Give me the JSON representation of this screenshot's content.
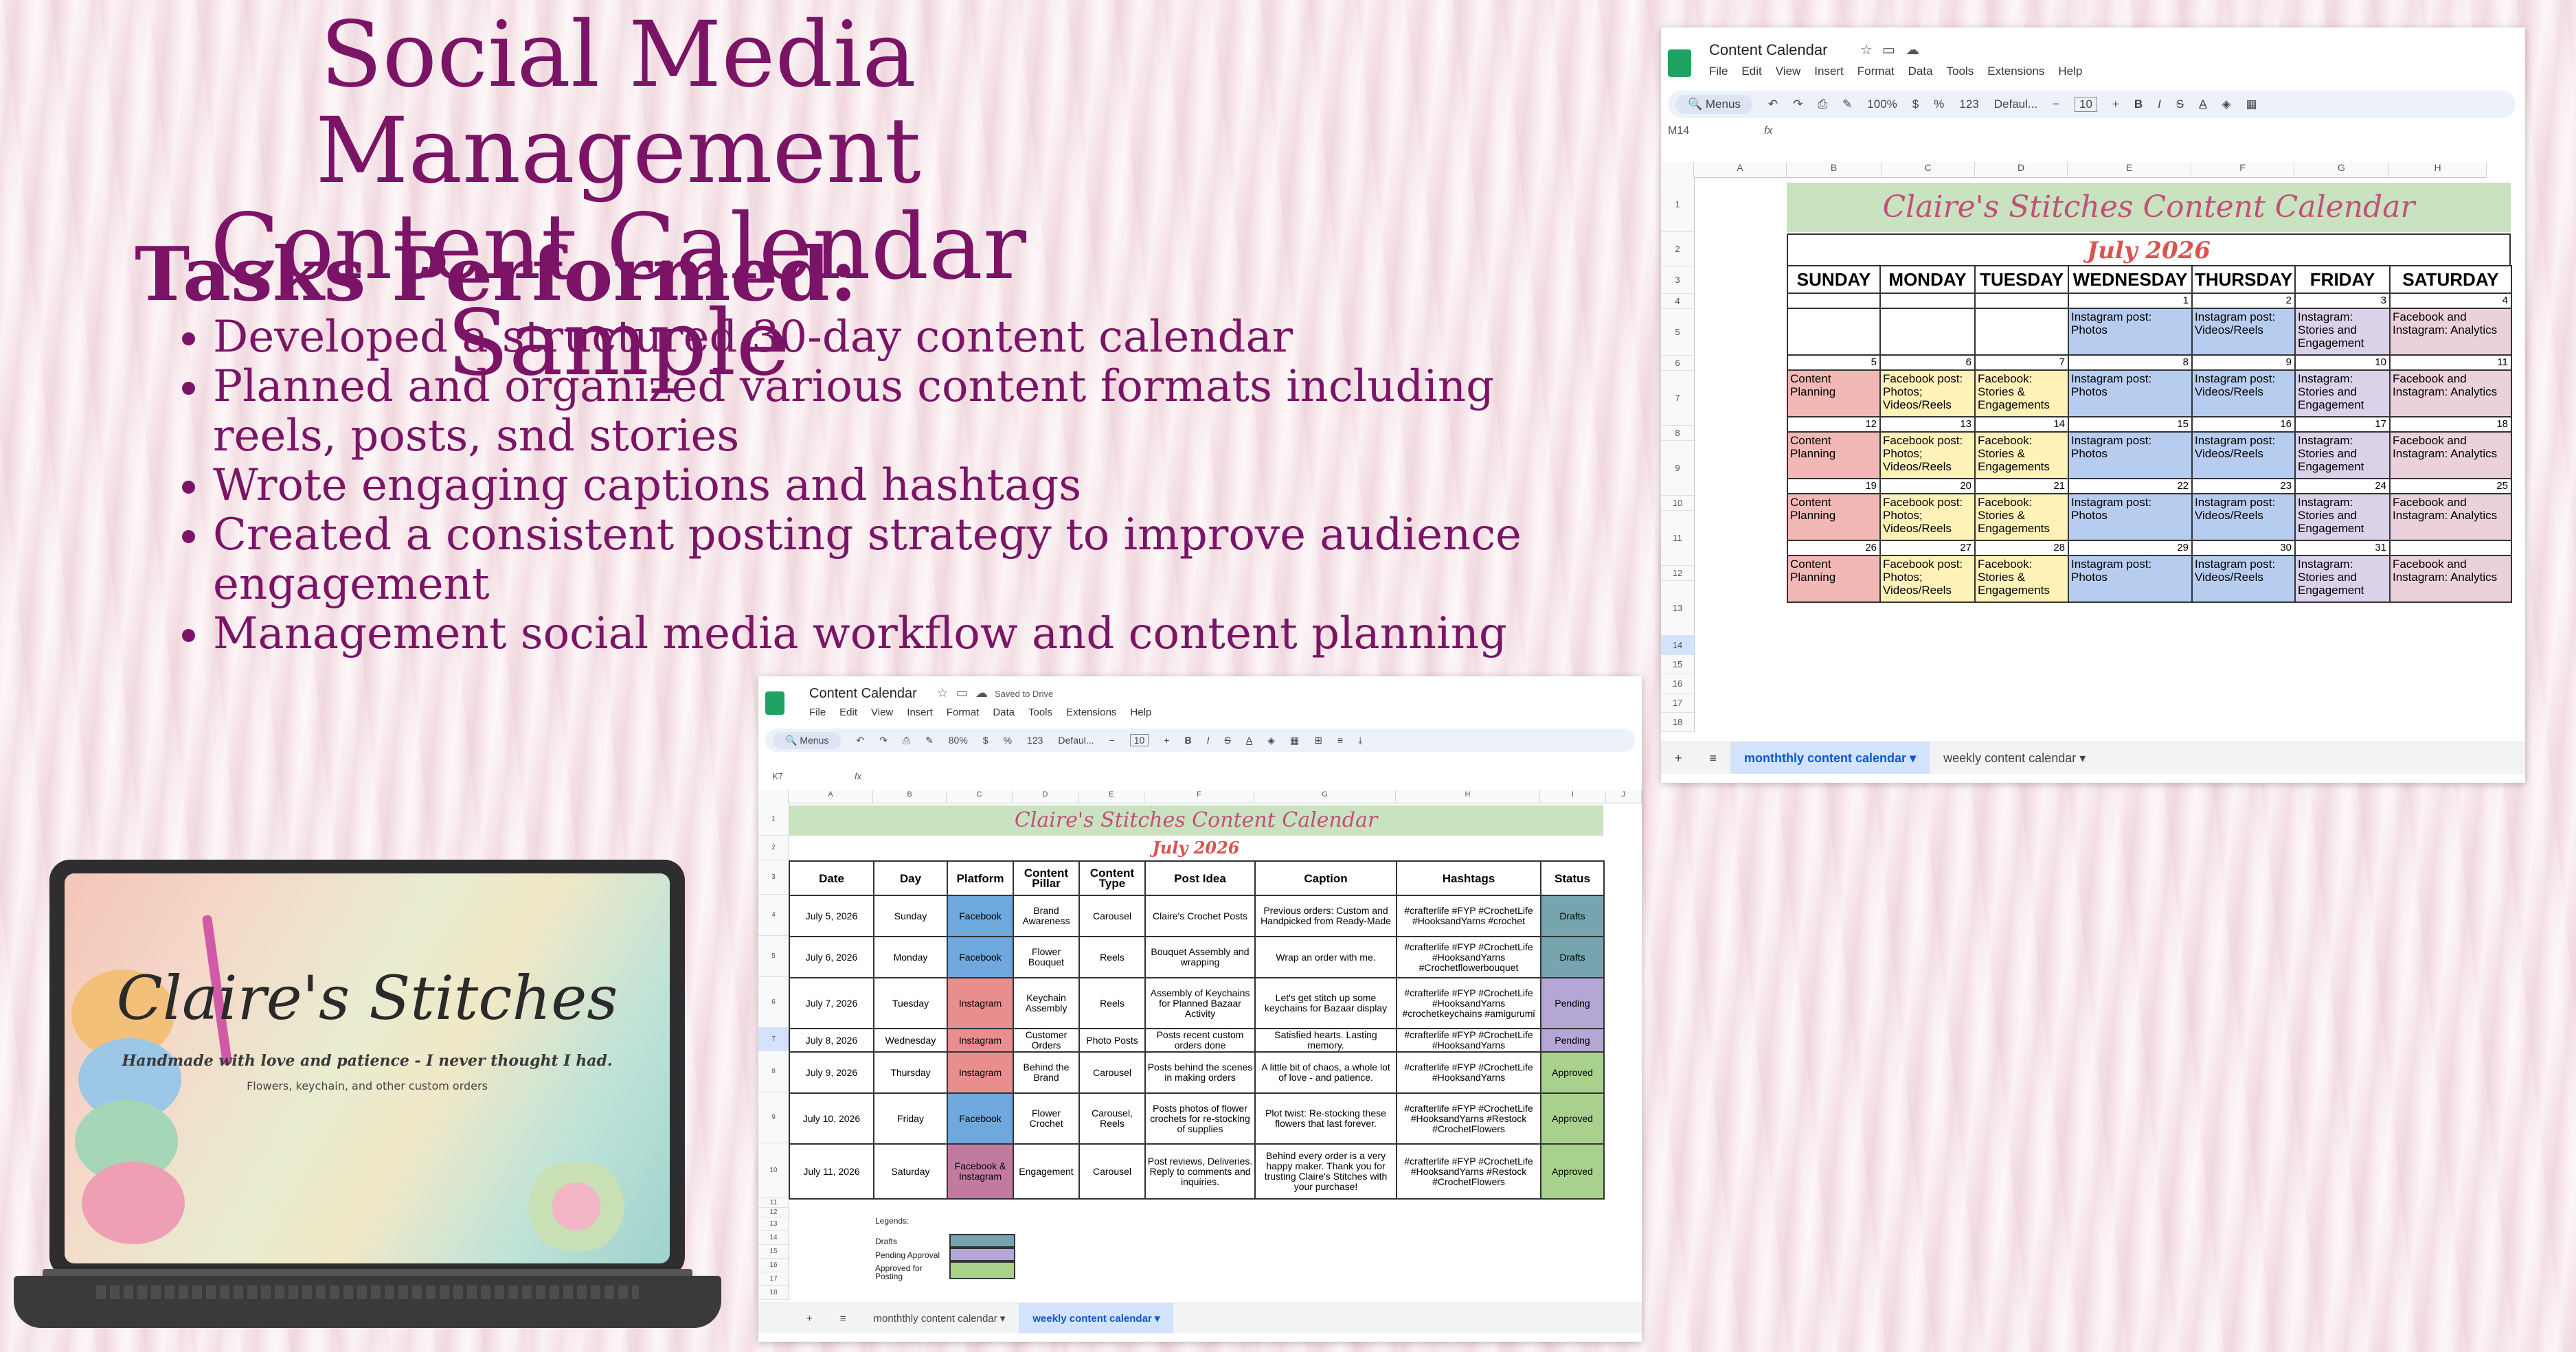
{
  "heading": {
    "title_line1": "Social Media Management",
    "title_line2": "Content Calendar Sample",
    "tasks_heading": "Tasks Performed:",
    "tasks": [
      "Developed a structured 30-day content calendar",
      "Planned and organized various content formats including reels, posts, snd stories",
      "Wrote engaging captions and hashtags",
      "Created a consistent posting strategy to improve audience engagement",
      "Management social media workflow and content planning"
    ]
  },
  "laptop": {
    "brand": "Claire's Stitches",
    "tagline": "Handmade with love and patience - I never thought I had.",
    "subline": "Flowers, keychain, and other custom orders"
  },
  "monthly_sheet": {
    "doc_title": "Content Calendar",
    "menu": [
      "File",
      "Edit",
      "View",
      "Insert",
      "Format",
      "Data",
      "Tools",
      "Extensions",
      "Help"
    ],
    "toolbar": {
      "search": "Menus",
      "zoom": "100%",
      "currency": "$",
      "percent": "%",
      "num": "123",
      "font": "Defaul...",
      "font_size": "10"
    },
    "cell_ref": "M14",
    "columns": [
      "A",
      "B",
      "C",
      "D",
      "E",
      "F",
      "G",
      "H"
    ],
    "rows": [
      "1",
      "2",
      "3",
      "4",
      "5",
      "6",
      "7",
      "8",
      "9",
      "10",
      "11",
      "12",
      "13",
      "14",
      "15",
      "16",
      "17",
      "18"
    ],
    "cal_title": "Claire's Stitches Content Calendar",
    "month": "July 2026",
    "days": [
      "SUNDAY",
      "MONDAY",
      "TUESDAY",
      "WEDNESDAY",
      "THURSDAY",
      "FRIDAY",
      "SATURDAY"
    ],
    "weeks": [
      {
        "nums": [
          "",
          "",
          "",
          "1",
          "2",
          "3",
          "4"
        ],
        "cells": [
          "",
          "",
          "",
          "Instagram post: Photos",
          "Instagram post: Videos/Reels",
          "Instagram: Stories and Engagement",
          "Facebook and Instagram: Analytics"
        ]
      },
      {
        "nums": [
          "5",
          "6",
          "7",
          "8",
          "9",
          "10",
          "11"
        ],
        "cells": [
          "Content Planning",
          "Facebook post: Photos; Videos/Reels",
          "Facebook: Stories & Engagements",
          "Instagram post: Photos",
          "Instagram post: Videos/Reels",
          "Instagram: Stories and Engagement",
          "Facebook and Instagram: Analytics"
        ]
      },
      {
        "nums": [
          "12",
          "13",
          "14",
          "15",
          "16",
          "17",
          "18"
        ],
        "cells": [
          "Content Planning",
          "Facebook post: Photos; Videos/Reels",
          "Facebook: Stories & Engagements",
          "Instagram post: Photos",
          "Instagram post: Videos/Reels",
          "Instagram: Stories and Engagement",
          "Facebook and Instagram: Analytics"
        ]
      },
      {
        "nums": [
          "19",
          "20",
          "21",
          "22",
          "23",
          "24",
          "25"
        ],
        "cells": [
          "Content Planning",
          "Facebook post: Photos; Videos/Reels",
          "Facebook: Stories & Engagements",
          "Instagram post: Photos",
          "Instagram post: Videos/Reels",
          "Instagram: Stories and Engagement",
          "Facebook and Instagram: Analytics"
        ]
      },
      {
        "nums": [
          "26",
          "27",
          "28",
          "29",
          "30",
          "31",
          ""
        ],
        "cells": [
          "Content Planning",
          "Facebook post: Photos; Videos/Reels",
          "Facebook: Stories & Engagements",
          "Instagram post: Photos",
          "Instagram post: Videos/Reels",
          "Instagram: Stories and Engagement",
          "Facebook and Instagram: Analytics"
        ]
      }
    ],
    "colors": {
      "planning": "#f2b8b5",
      "facebook": "#fff2b8",
      "fb_stories": "#fff2b8",
      "ig_photos": "#b7cdf0",
      "ig_reels": "#b7cdf0",
      "ig_stories": "#d9d2e9",
      "analytics": "#ead1dc",
      "title_bg": "#c9e2c0"
    },
    "tabs": {
      "monthly": "monththly content calendar",
      "weekly": "weekly content calendar"
    }
  },
  "weekly_sheet": {
    "doc_title": "Content Calendar",
    "saved": "Saved to Drive",
    "menu": [
      "File",
      "Edit",
      "View",
      "Insert",
      "Format",
      "Data",
      "Tools",
      "Extensions",
      "Help"
    ],
    "toolbar": {
      "search": "Menus",
      "zoom": "80%",
      "currency": "$",
      "percent": "%",
      "num": "123",
      "font": "Defaul...",
      "font_size": "10"
    },
    "cell_ref": "K7",
    "columns": [
      "A",
      "B",
      "C",
      "D",
      "E",
      "F",
      "G",
      "H",
      "I",
      "J"
    ],
    "rows": [
      "1",
      "2",
      "3",
      "4",
      "5",
      "6",
      "7",
      "8",
      "9",
      "10",
      "11",
      "12",
      "13",
      "14",
      "15",
      "16",
      "17",
      "18"
    ],
    "cal_title": "Claire's Stitches Content Calendar",
    "month": "July 2026",
    "headers": [
      "Date",
      "Day",
      "Platform",
      "Content Pillar",
      "Content Type",
      "Post Idea",
      "Caption",
      "Hashtags",
      "Status"
    ],
    "rows_data": [
      {
        "date": "July 5, 2026",
        "day": "Sunday",
        "platform": "Facebook",
        "pillar": "Brand Awareness",
        "type": "Carousel",
        "idea": "Claire's Crochet Posts",
        "caption": "Previous orders: Custom and Handpicked from Ready-Made",
        "tags": "#crafterlife #FYP #CrochetLife #HooksandYarns #crochet",
        "status": "Drafts"
      },
      {
        "date": "July 6, 2026",
        "day": "Monday",
        "platform": "Facebook",
        "pillar": "Flower Bouquet",
        "type": "Reels",
        "idea": "Bouquet Assembly and wrapping",
        "caption": "Wrap an order with me.",
        "tags": "#crafterlife #FYP #CrochetLife #HooksandYarns #Crochetflowerbouquet",
        "status": "Drafts"
      },
      {
        "date": "July 7, 2026",
        "day": "Tuesday",
        "platform": "Instagram",
        "pillar": "Keychain Assembly",
        "type": "Reels",
        "idea": "Assembly of Keychains for Planned Bazaar Activity",
        "caption": "Let's get stitch up some keychains for Bazaar display",
        "tags": "#crafterlife #FYP #CrochetLife #HooksandYarns #crochetkeychains #amigurumi",
        "status": "Pending"
      },
      {
        "date": "July 8, 2026",
        "day": "Wednesday",
        "platform": "Instagram",
        "pillar": "Customer Orders",
        "type": "Photo Posts",
        "idea": "Posts recent custom orders done",
        "caption": "Satisfied hearts. Lasting memory.",
        "tags": "#crafterlife #FYP #CrochetLife #HooksandYarns",
        "status": "Pending"
      },
      {
        "date": "July 9, 2026",
        "day": "Thursday",
        "platform": "Instagram",
        "pillar": "Behind the Brand",
        "type": "Carousel",
        "idea": "Posts behind the scenes in making orders",
        "caption": "A little bit of chaos, a whole lot of love - and patience.",
        "tags": "#crafterlife #FYP #CrochetLife #HooksandYarns",
        "status": "Approved"
      },
      {
        "date": "July 10, 2026",
        "day": "Friday",
        "platform": "Facebook",
        "pillar": "Flower Crochet",
        "type": "Carousel, Reels",
        "idea": "Posts photos of flower crochets for re-stocking of supplies",
        "caption": "Plot twist: Re-stocking these flowers that last forever.",
        "tags": "#crafterlife #FYP #CrochetLife #HooksandYarns #Restock #CrochetFlowers",
        "status": "Approved"
      },
      {
        "date": "July 11, 2026",
        "day": "Saturday",
        "platform": "Facebook & Instagram",
        "pillar": "Engagement",
        "type": "Carousel",
        "idea": "Post reviews, Deliveries. Reply to comments and inquiries.",
        "caption": "Behind every order is a very happy maker. Thank you for trusting Claire's Stitches with your purchase!",
        "tags": "#crafterlife #FYP #CrochetLife #HooksandYarns #Restock #CrochetFlowers",
        "status": "Approved"
      }
    ],
    "legend": {
      "title": "Legends:",
      "drafts": "Drafts",
      "pending": "Pending Approval",
      "approved": "Approved for Posting"
    },
    "colors": {
      "facebook": "#6fa8dc",
      "instagram": "#e88e8e",
      "fb_ig": "#c27ba0",
      "drafts": "#76a5af",
      "pending": "#b4a7d6",
      "approved": "#a9d18e"
    },
    "tabs": {
      "monthly": "monththly content calendar",
      "weekly": "weekly content calendar"
    }
  }
}
